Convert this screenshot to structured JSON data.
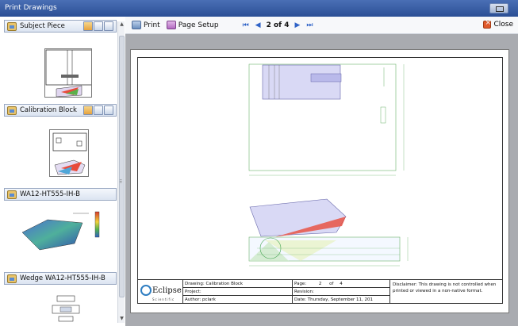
{
  "window": {
    "title": "Print Drawings"
  },
  "sidebar": {
    "panels": [
      {
        "label": "Subject Piece"
      },
      {
        "label": "Calibration Block"
      },
      {
        "label": "WA12-HT555-IH-B"
      },
      {
        "label": "Wedge WA12-HT555-IH-B"
      }
    ]
  },
  "toolbar": {
    "print_label": "Print",
    "page_setup_label": "Page Setup",
    "page_indicator": "2 of 4",
    "close_label": "Close"
  },
  "title_block": {
    "logo_text": "Eclipse",
    "logo_sub": "Scientific",
    "drawing": "Drawing: Calibration Block",
    "project": "Project:",
    "author": "Author:   pclark",
    "page_label": "Page:",
    "page_num": "2",
    "page_of": "of",
    "page_total": "4",
    "revision": "Revision:",
    "date": "Date: Thursday, September 11, 201",
    "disclaimer": "Disclaimer: This drawing is not controlled when printed or viewed in a non-native format."
  },
  "colors": {
    "titlebar": "#2b4f95",
    "accent": "#2f63c7",
    "close": "#e05a2b"
  }
}
